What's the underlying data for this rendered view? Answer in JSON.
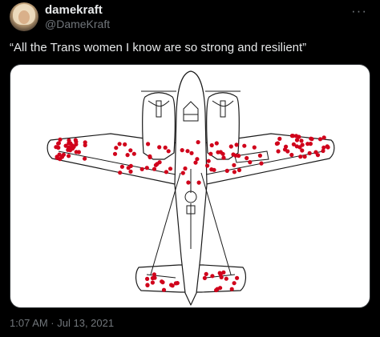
{
  "author": {
    "display_name": "damekraft",
    "handle": "@DameKraft"
  },
  "icons": {
    "more": "more-options-icon"
  },
  "tweet": {
    "text": "“All the Trans women I know are so strong and resilient”",
    "timestamp": "1:07 AM · Jul 13, 2021"
  },
  "colors": {
    "background": "#000000",
    "text": "#e7e9ea",
    "secondary_text": "#71767b",
    "damage_dot": "#d0021b"
  }
}
